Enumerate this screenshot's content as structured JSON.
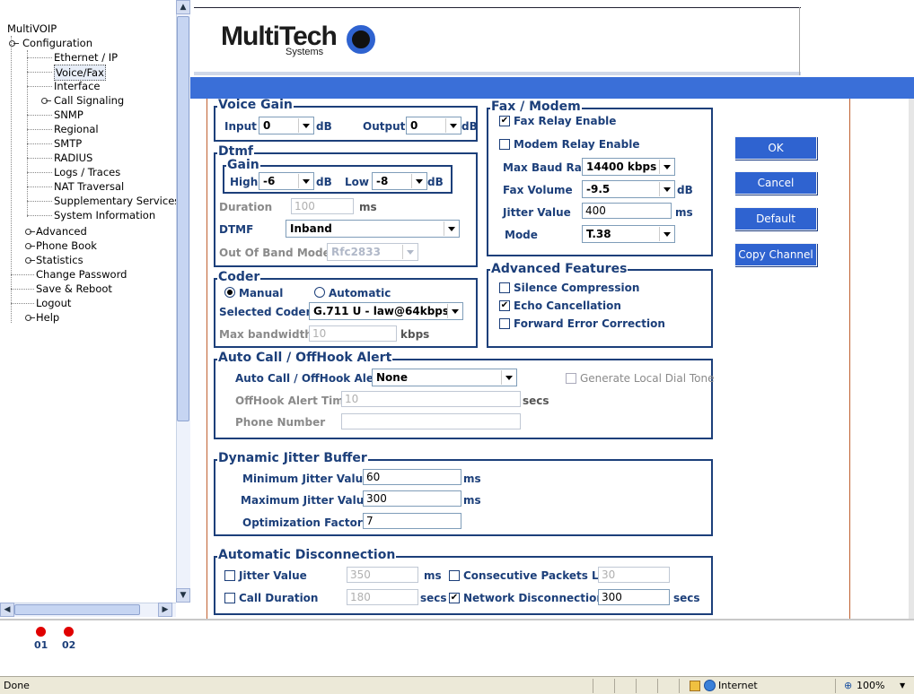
{
  "tree": {
    "root": "MultiVOIP",
    "configuration": "Configuration",
    "items": [
      "Ethernet / IP",
      "Voice/Fax",
      "Interface",
      "Call Signaling",
      "SNMP",
      "Regional",
      "SMTP",
      "RADIUS",
      "Logs / Traces",
      "NAT Traversal",
      "Supplementary Services",
      "System Information"
    ],
    "advanced": "Advanced",
    "phonebook": "Phone Book",
    "statistics": "Statistics",
    "change_password": "Change Password",
    "save_reboot": "Save & Reboot",
    "logout": "Logout",
    "help": "Help"
  },
  "logo": {
    "main": "MultiTech",
    "sub": "Systems"
  },
  "voice_gain": {
    "title": "Voice Gain",
    "input_label": "Input",
    "input_value": "0",
    "db": "dB",
    "output_label": "Output",
    "output_value": "0"
  },
  "dtmf": {
    "title": "Dtmf",
    "gain_title": "Gain",
    "high_label": "High",
    "high_value": "-6",
    "low_label": "Low",
    "low_value": "-8",
    "db": "dB",
    "duration_label": "Duration",
    "duration_value": "100",
    "ms": "ms",
    "dtmf_label": "DTMF",
    "dtmf_value": "Inband",
    "oob_label": "Out Of Band Mode",
    "oob_value": "Rfc2833"
  },
  "coder": {
    "title": "Coder",
    "manual": "Manual",
    "automatic": "Automatic",
    "selected_label": "Selected Coder",
    "selected_value": "G.711 U - law@64kbps",
    "maxbw_label": "Max bandwidth",
    "maxbw_value": "10",
    "kbps": "kbps"
  },
  "fax": {
    "title": "Fax / Modem",
    "fax_relay": "Fax Relay Enable",
    "modem_relay": "Modem Relay Enable",
    "baud_label": "Max Baud Rate",
    "baud_value": "14400 kbps",
    "volume_label": "Fax Volume",
    "volume_value": "-9.5",
    "db": "dB",
    "jitter_label": "Jitter Value",
    "jitter_value": "400",
    "ms": "ms",
    "mode_label": "Mode",
    "mode_value": "T.38"
  },
  "advanced": {
    "title": "Advanced Features",
    "silence": "Silence Compression",
    "echo": "Echo Cancellation",
    "fec": "Forward Error Correction"
  },
  "buttons": {
    "ok": "OK",
    "cancel": "Cancel",
    "default": "Default",
    "copy": "Copy Channel"
  },
  "auto_call": {
    "title": "Auto Call / OffHook Alert",
    "label": "Auto Call / OffHook Alert",
    "value": "None",
    "local_tone": "Generate Local Dial Tone",
    "timer_label": "OffHook Alert Timer",
    "timer_value": "10",
    "secs": "secs",
    "phone_label": "Phone Number",
    "phone_value": ""
  },
  "jitter": {
    "title": "Dynamic Jitter Buffer",
    "min_label": "Minimum Jitter Value",
    "min_value": "60",
    "max_label": "Maximum Jitter Value",
    "max_value": "300",
    "ms": "ms",
    "opt_label": "Optimization Factor",
    "opt_value": "7"
  },
  "disconnect": {
    "title": "Automatic Disconnection",
    "jitter_label": "Jitter Value",
    "jitter_value": "350",
    "ms": "ms",
    "packets_label": "Consecutive Packets Lost",
    "packets_value": "30",
    "call_label": "Call Duration",
    "call_value": "180",
    "secs": "secs",
    "network_label": "Network Disconnection",
    "network_value": "300"
  },
  "channels": [
    "01",
    "02"
  ],
  "status": {
    "text": "Done",
    "zone": "Internet",
    "zoom": "100%"
  }
}
